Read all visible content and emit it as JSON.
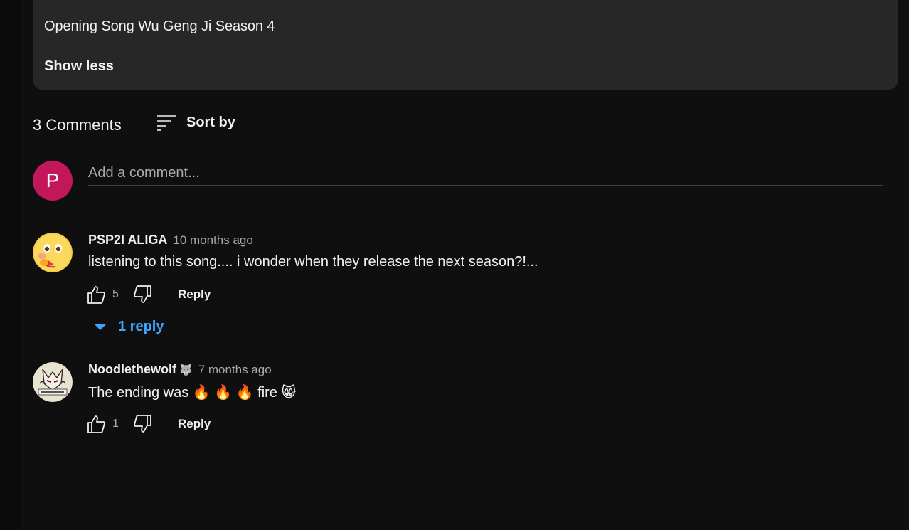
{
  "description": {
    "text": "Opening Song Wu Geng Ji Season 4",
    "show_less_label": "Show less"
  },
  "comments_header": {
    "count_label": "3 Comments",
    "sort_label": "Sort by"
  },
  "add_comment": {
    "avatar_letter": "P",
    "placeholder": "Add a comment...",
    "avatar_color": "#c2185b"
  },
  "comments": [
    {
      "author": "PSP2I ALIGA",
      "time": "10 months ago",
      "text": "listening to this song.... i wonder when they release the next season?!...",
      "likes": "5",
      "reply_label": "Reply",
      "replies_label": "1 reply",
      "avatar_icon": "face-holding-back-tears-emoji"
    },
    {
      "author": "Noodlethewolf",
      "badge": "🐺",
      "time": "7 months ago",
      "text": "The ending was 🔥 🔥 🔥 fire 😸",
      "likes": "1",
      "reply_label": "Reply",
      "avatar_icon": "wolf-character-avatar"
    }
  ],
  "colors": {
    "background": "#0f0f0f",
    "description_bg": "#272727",
    "link_blue": "#3ea6ff",
    "secondary_text": "#aaaaaa"
  }
}
